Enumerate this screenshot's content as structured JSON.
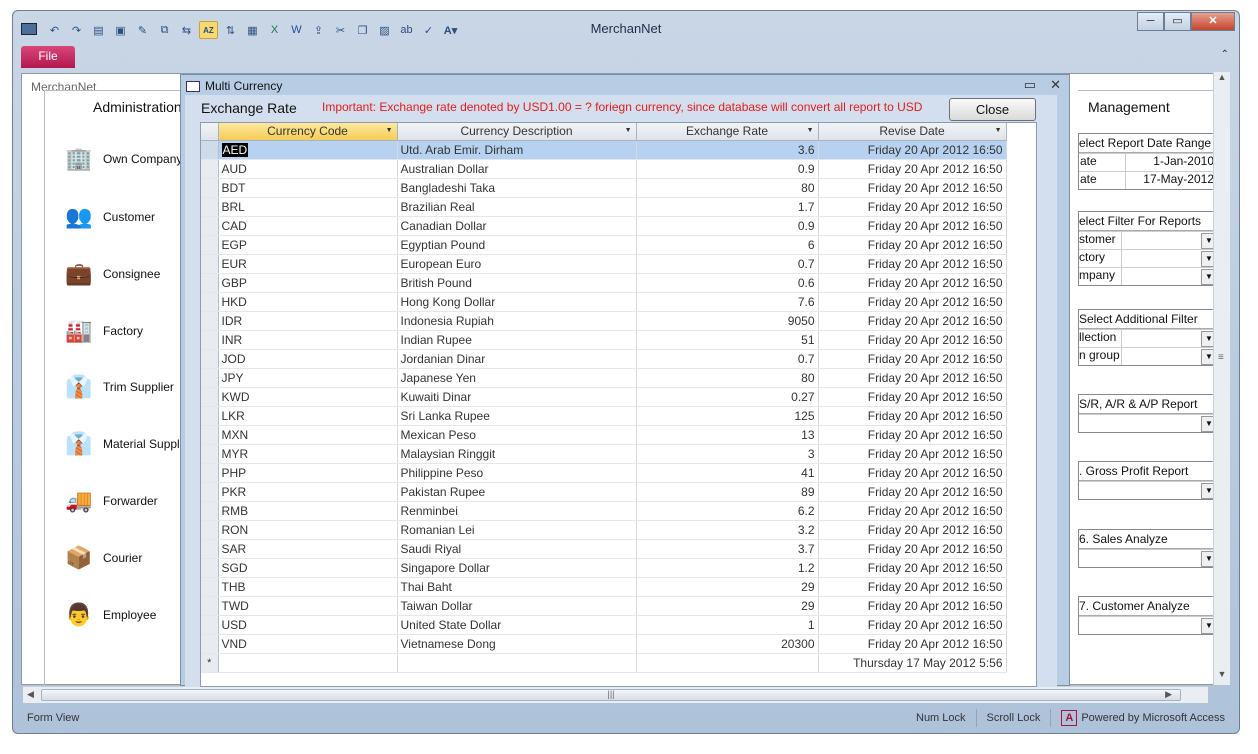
{
  "app": {
    "title": "MerchanNet",
    "file_tab": "File",
    "doc_tab": "MerchanNet"
  },
  "window_buttons": {
    "minimize": "─",
    "maximize": "▭",
    "close": "✕"
  },
  "toolbar": {
    "icons": [
      "undo-icon",
      "redo-icon",
      "new-record-icon",
      "save-icon",
      "find-icon",
      "copy-icon",
      "paste-special-icon",
      "sort-az-icon",
      "sort-za-icon",
      "report-icon",
      "excel-icon",
      "word-icon",
      "export-icon",
      "cut-icon",
      "copy2-icon",
      "paste-icon",
      "replace-icon",
      "spell-icon",
      "font-icon"
    ],
    "sort_az_label": "AZ"
  },
  "admin": {
    "title": "Administration",
    "items": [
      {
        "label": "Own Company",
        "icon": "building-icon"
      },
      {
        "label": "Customer",
        "icon": "users-icon"
      },
      {
        "label": "Consignee",
        "icon": "briefcase-icon"
      },
      {
        "label": "Factory",
        "icon": "factory-icon"
      },
      {
        "label": "Trim Supplier",
        "icon": "people-icon"
      },
      {
        "label": "Material Supplier",
        "icon": "people2-icon"
      },
      {
        "label": "Forwarder",
        "icon": "truck-icon"
      },
      {
        "label": "Courier",
        "icon": "package-icon"
      },
      {
        "label": "Employee",
        "icon": "employee-icon"
      }
    ]
  },
  "management": {
    "title": "Management",
    "date_range": {
      "header": "elect Report Date Range",
      "rows": [
        {
          "label": "ate",
          "value": "1-Jan-2010"
        },
        {
          "label": "ate",
          "value": "17-May-2012"
        }
      ]
    },
    "filters": {
      "header": "elect Filter For Reports",
      "rows": [
        "stomer",
        "ctory",
        "mpany"
      ]
    },
    "additional": {
      "header": "Select Additional Filter",
      "rows": [
        "llection",
        "n group"
      ]
    },
    "reports": [
      {
        "header": "S/R, A/R & A/P Report"
      },
      {
        "header": ". Gross Profit Report"
      },
      {
        "header": "6. Sales Analyze"
      },
      {
        "header": "7. Customer Analyze"
      }
    ]
  },
  "dialog": {
    "title": "Multi Currency",
    "heading": "Exchange Rate",
    "notice": "Important: Exchange rate denoted by  USD1.00 = ? foriegn currency, since database will convert all report to USD",
    "close_label": "Close",
    "minimize": "▭",
    "close_x": "✕",
    "columns": [
      "Currency Code",
      "Currency Description",
      "Exchange Rate",
      "Revise Date"
    ],
    "rows": [
      {
        "code": "AED",
        "desc": "Utd. Arab Emir. Dirham",
        "rate": "3.6",
        "date": "Friday 20 Apr 2012 16:50"
      },
      {
        "code": "AUD",
        "desc": "Australian Dollar",
        "rate": "0.9",
        "date": "Friday 20 Apr 2012 16:50"
      },
      {
        "code": "BDT",
        "desc": "Bangladeshi Taka",
        "rate": "80",
        "date": "Friday 20 Apr 2012 16:50"
      },
      {
        "code": "BRL",
        "desc": "Brazilian Real",
        "rate": "1.7",
        "date": "Friday 20 Apr 2012 16:50"
      },
      {
        "code": "CAD",
        "desc": "Canadian Dollar",
        "rate": "0.9",
        "date": "Friday 20 Apr 2012 16:50"
      },
      {
        "code": "EGP",
        "desc": "Egyptian Pound",
        "rate": "6",
        "date": "Friday 20 Apr 2012 16:50"
      },
      {
        "code": "EUR",
        "desc": "European Euro",
        "rate": "0.7",
        "date": "Friday 20 Apr 2012 16:50"
      },
      {
        "code": "GBP",
        "desc": "British Pound",
        "rate": "0.6",
        "date": "Friday 20 Apr 2012 16:50"
      },
      {
        "code": "HKD",
        "desc": "Hong Kong Dollar",
        "rate": "7.6",
        "date": "Friday 20 Apr 2012 16:50"
      },
      {
        "code": "IDR",
        "desc": "Indonesia Rupiah",
        "rate": "9050",
        "date": "Friday 20 Apr 2012 16:50"
      },
      {
        "code": "INR",
        "desc": "Indian Rupee",
        "rate": "51",
        "date": "Friday 20 Apr 2012 16:50"
      },
      {
        "code": "JOD",
        "desc": "Jordanian Dinar",
        "rate": "0.7",
        "date": "Friday 20 Apr 2012 16:50"
      },
      {
        "code": "JPY",
        "desc": "Japanese Yen",
        "rate": "80",
        "date": "Friday 20 Apr 2012 16:50"
      },
      {
        "code": "KWD",
        "desc": "Kuwaiti Dinar",
        "rate": "0.27",
        "date": "Friday 20 Apr 2012 16:50"
      },
      {
        "code": "LKR",
        "desc": "Sri Lanka Rupee",
        "rate": "125",
        "date": "Friday 20 Apr 2012 16:50"
      },
      {
        "code": "MXN",
        "desc": "Mexican Peso",
        "rate": "13",
        "date": "Friday 20 Apr 2012 16:50"
      },
      {
        "code": "MYR",
        "desc": "Malaysian Ringgit",
        "rate": "3",
        "date": "Friday 20 Apr 2012 16:50"
      },
      {
        "code": "PHP",
        "desc": "Philippine Peso",
        "rate": "41",
        "date": "Friday 20 Apr 2012 16:50"
      },
      {
        "code": "PKR",
        "desc": "Pakistan Rupee",
        "rate": "89",
        "date": "Friday 20 Apr 2012 16:50"
      },
      {
        "code": "RMB",
        "desc": "Renminbei",
        "rate": "6.2",
        "date": "Friday 20 Apr 2012 16:50"
      },
      {
        "code": "RON",
        "desc": "Romanian Lei",
        "rate": "3.2",
        "date": "Friday 20 Apr 2012 16:50"
      },
      {
        "code": "SAR",
        "desc": "Saudi Riyal",
        "rate": "3.7",
        "date": "Friday 20 Apr 2012 16:50"
      },
      {
        "code": "SGD",
        "desc": "Singapore Dollar",
        "rate": "1.2",
        "date": "Friday 20 Apr 2012 16:50"
      },
      {
        "code": "THB",
        "desc": "Thai Baht",
        "rate": "29",
        "date": "Friday 20 Apr 2012 16:50"
      },
      {
        "code": "TWD",
        "desc": "Taiwan Dollar",
        "rate": "29",
        "date": "Friday 20 Apr 2012 16:50"
      },
      {
        "code": "USD",
        "desc": "United State Dollar",
        "rate": "1",
        "date": "Friday 20 Apr 2012 16:50"
      },
      {
        "code": "VND",
        "desc": "Vietnamese Dong",
        "rate": "20300",
        "date": "Friday 20 Apr 2012 16:50"
      }
    ],
    "new_row_marker": "*",
    "new_row_date": "Thursday 17 May 2012 5:56"
  },
  "status": {
    "view": "Form View",
    "num_lock": "Num Lock",
    "scroll_lock": "Scroll Lock",
    "powered": "Powered by Microsoft Access",
    "access_logo": "A"
  },
  "colors": {
    "file_tab": "#c2185b",
    "selected_row": "#b6d2f0",
    "notice": "#e41b1b"
  }
}
